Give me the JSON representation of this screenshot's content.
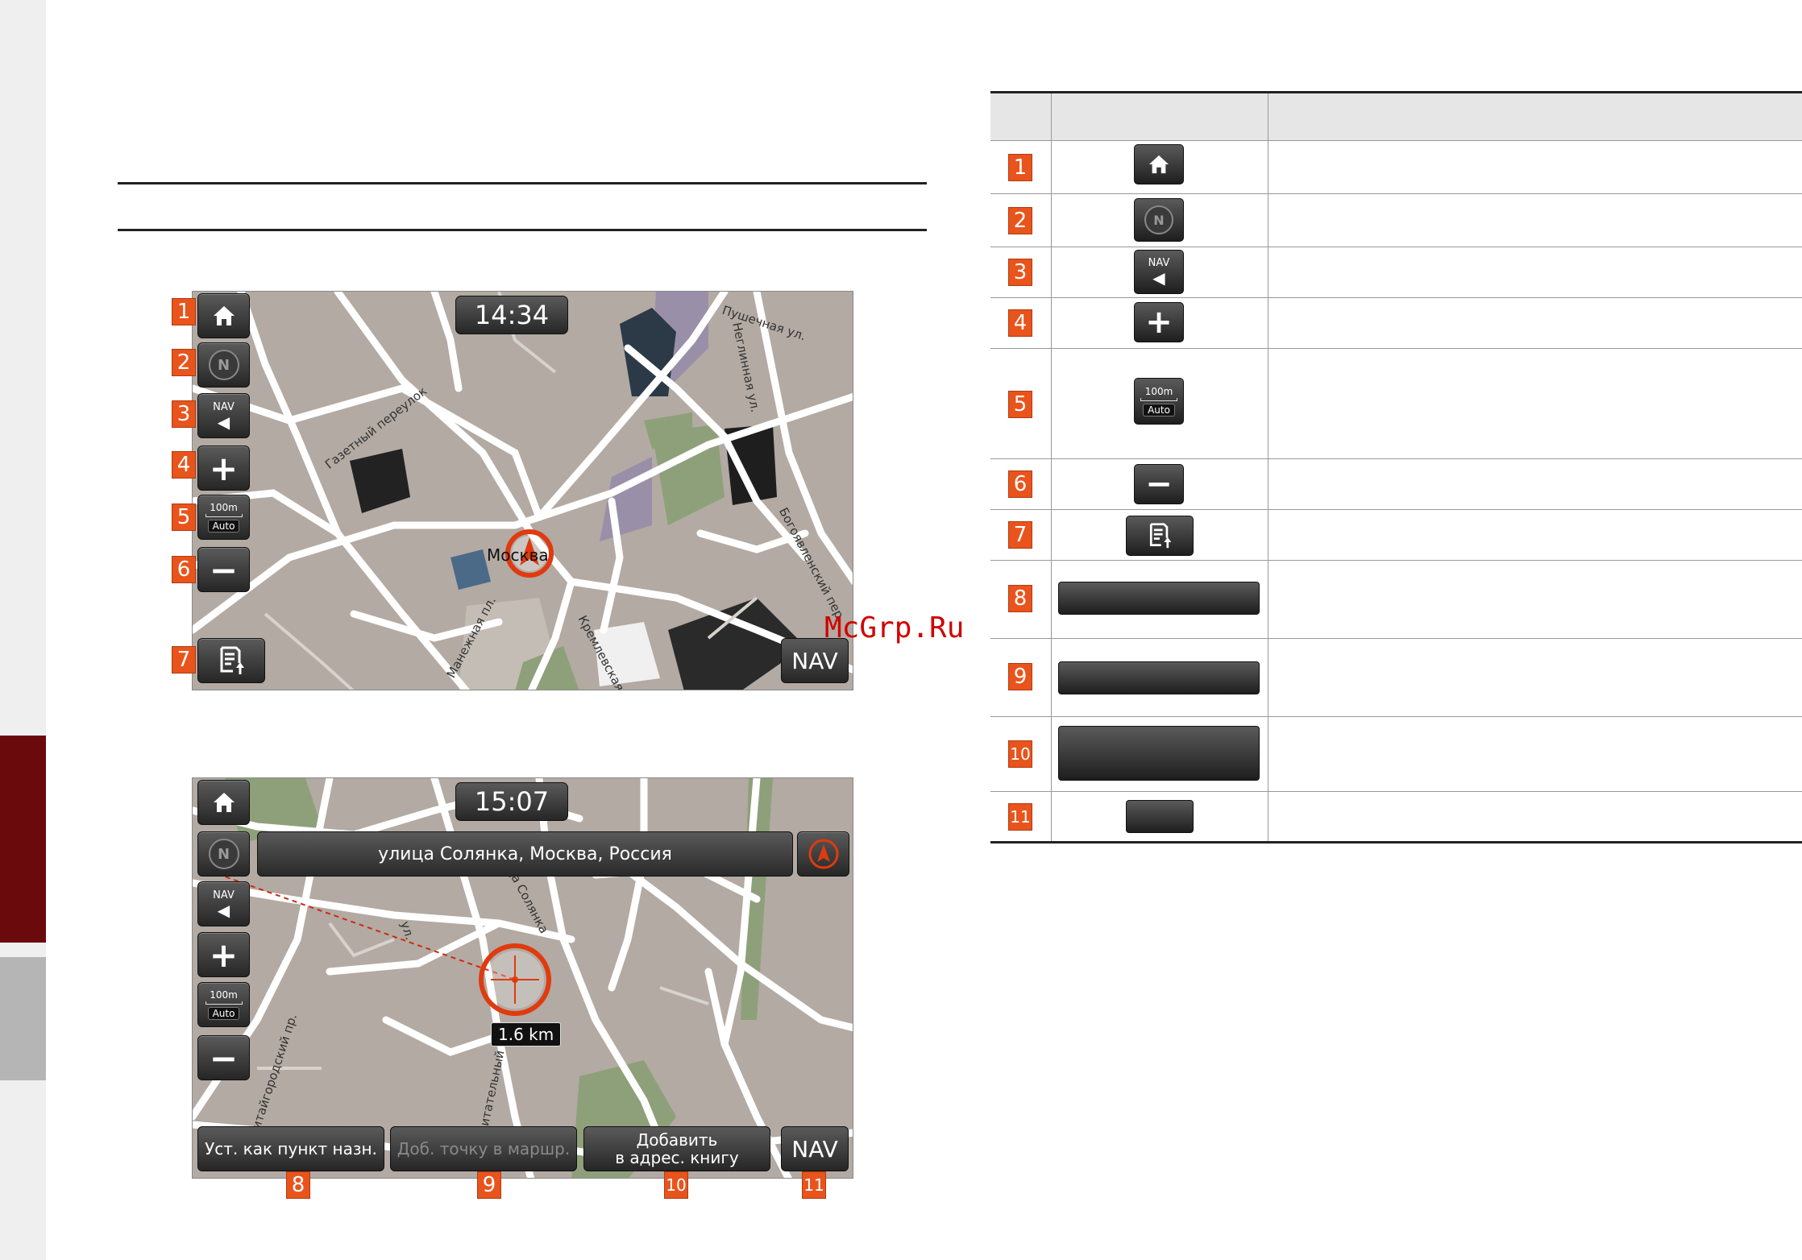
{
  "screen1": {
    "clock": "14:34",
    "nav_label": "NAV",
    "speaker_label": "NAV",
    "scale_distance": "100m",
    "scale_mode": "Auto",
    "badges": [
      "1",
      "2",
      "3",
      "4",
      "5",
      "6",
      "7"
    ],
    "streets": {
      "gazetny": "Газетный переулок",
      "pushechnaya": "Пушечная ул.",
      "neglinnaya": "Неглинная ул.",
      "moskva": "Москва",
      "manezhnaya": "Манежная пл.",
      "kremlevskaya": "Кремлевская",
      "bogoyavlensky": "Богоявленский пер."
    }
  },
  "screen2": {
    "clock": "15:07",
    "address": "улица Солянка, Москва, Россия",
    "distance": "1.6 km",
    "nav_label": "NAV",
    "speaker_label": "NAV",
    "scale_distance": "100m",
    "scale_mode": "Auto",
    "buttons": {
      "set_destination": "Уст. как пункт назн.",
      "add_waypoint": "Доб. точку в маршр.",
      "add_to_address_book_line1": "Добавить",
      "add_to_address_book_line2": "в адрес. книгу"
    },
    "badges": [
      "8",
      "9",
      "10",
      "11"
    ],
    "streets": {
      "solyanka": "улица Солянка",
      "kitaygorodsky": "Китайгородский пр.",
      "vospitatelny": "Воспитательный пр.",
      "ilyinka": "ул."
    }
  },
  "table": {
    "row_numbers": [
      "1",
      "2",
      "3",
      "4",
      "5",
      "6",
      "7",
      "8",
      "9",
      "10",
      "11"
    ],
    "nav_label": "NAV",
    "scale_distance": "100m",
    "scale_mode": "Auto"
  },
  "watermark": "McGrp.Ru",
  "colors": {
    "badge": "#e8541c",
    "side_tab": "#6b0a0c",
    "map_bg": "#b0a8a0",
    "road": "#ffffff",
    "accent_marker": "#e03a10"
  }
}
